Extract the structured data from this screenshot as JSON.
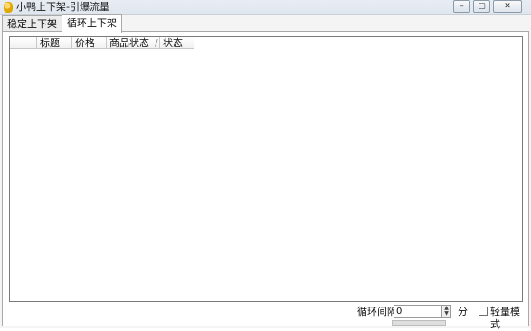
{
  "window": {
    "title": "小鸭上下架-引爆流量",
    "minimize_glyph": "–",
    "maximize_glyph": "▢",
    "close_glyph": "✕"
  },
  "tabs": [
    {
      "label": "稳定上下架",
      "active": false
    },
    {
      "label": "循环上下架",
      "active": true
    }
  ],
  "list": {
    "columns": [
      "",
      "标题",
      "价格",
      "商品状态",
      "状态"
    ],
    "sort_indicator": "/"
  },
  "bottom": {
    "interval_label": "循环间隔",
    "interval_value": "0",
    "unit_label": "分",
    "checkbox_label": "轻量模式"
  },
  "colors": {
    "titlebar": "#e3e9f0",
    "panel": "#ffffff",
    "border": "#a9a9a9"
  }
}
